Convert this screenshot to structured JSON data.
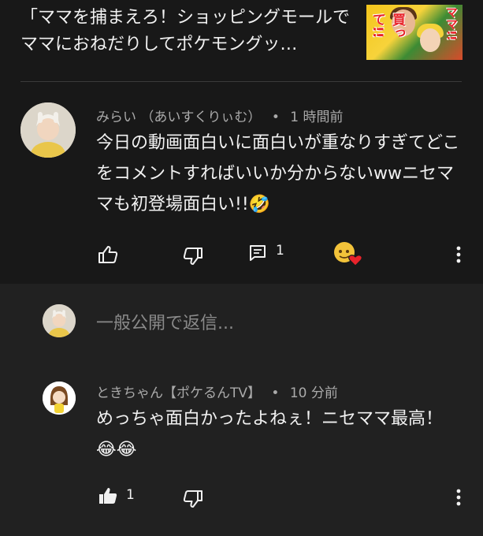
{
  "video": {
    "title": "「ママを捕まえろ！ショッピングモールでママにおねだりしてポケモングッ…",
    "thumb_left": "買って!!",
    "thumb_right": "ママ!!"
  },
  "comment": {
    "author": "みらい （あいすくりぃむ）",
    "time": "1 時間前",
    "text": "今日の動画面白いに面白いが重なりすぎてどこをコメントすればいいか分からないwwニセママも初登場面白い!!🤣",
    "reply_count": "1",
    "heart_emoji": "❤"
  },
  "reply_input": {
    "placeholder": "一般公開で返信..."
  },
  "reply": {
    "author": "ときちゃん【ポケるんTV】",
    "time": "10 分前",
    "text": "めっちゃ面白かったよねぇ！ニセママ最高！😂😂",
    "like_count": "1"
  },
  "separator": "•"
}
